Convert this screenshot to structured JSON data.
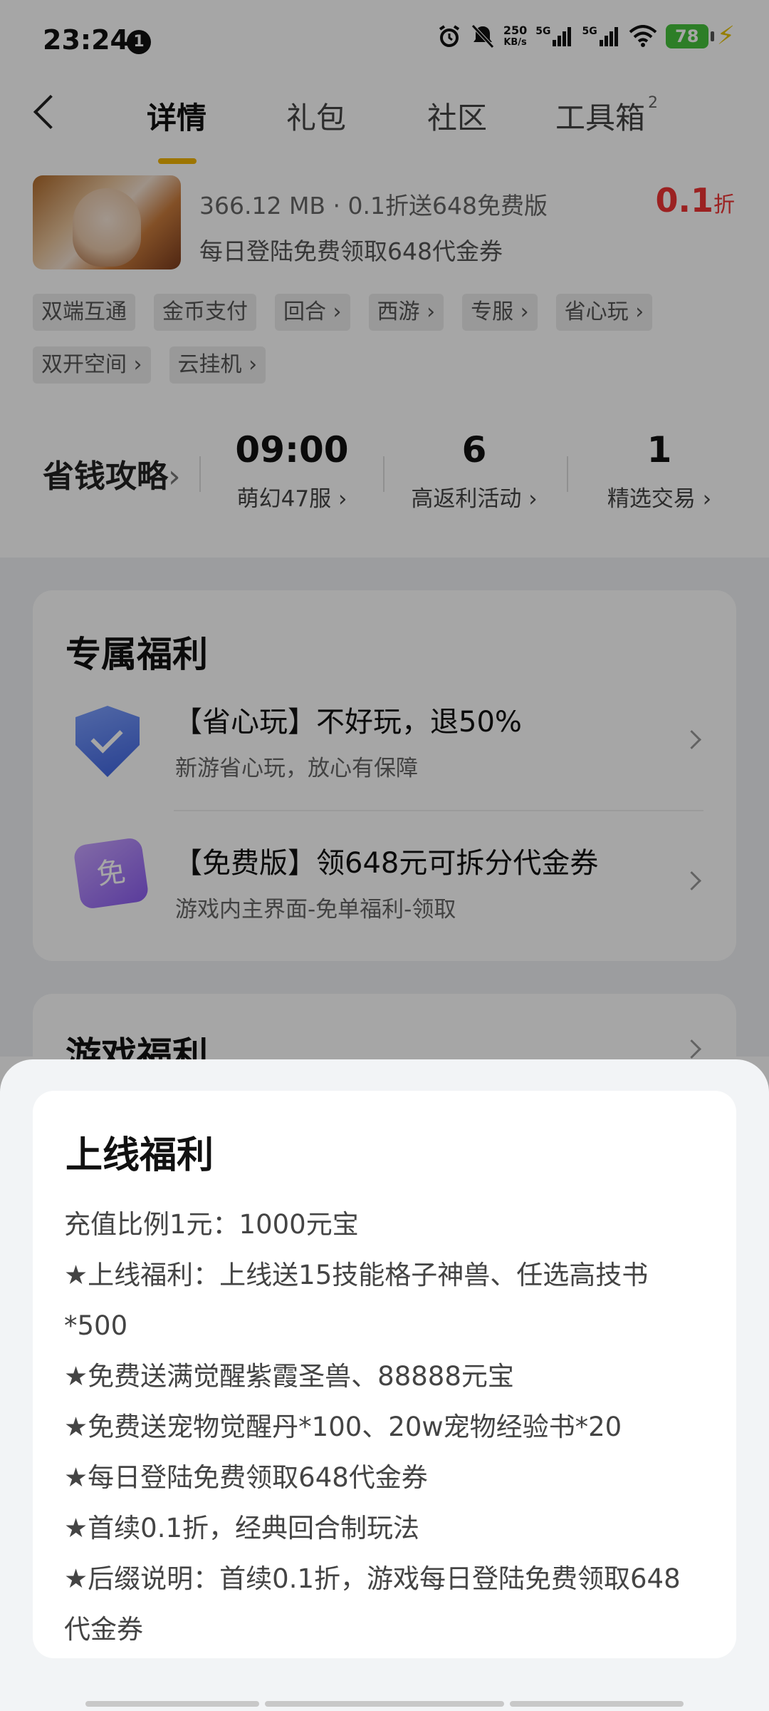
{
  "status_bar": {
    "time": "23:24",
    "notification_count": "1",
    "net_speed_value": "250",
    "net_speed_unit": "KB/s",
    "signal1_label": "5G",
    "signal2_label": "5G",
    "battery": "78",
    "icons": [
      "alarm-icon",
      "mute-icon",
      "signal-icon",
      "signal-icon",
      "wifi-icon",
      "battery-icon",
      "charging-icon"
    ]
  },
  "tabs": [
    {
      "label": "详情"
    },
    {
      "label": "礼包"
    },
    {
      "label": "社区"
    },
    {
      "label": "工具箱",
      "badge": "2"
    }
  ],
  "game": {
    "meta": "366.12 MB · 0.1折送648免费版",
    "desc": "每日登陆免费领取648代金券",
    "discount_value": "0.1",
    "discount_unit": "折"
  },
  "tags": [
    "双端互通",
    "金币支付",
    "回合",
    "西游",
    "专服",
    "省心玩",
    "双开空间",
    "云挂机"
  ],
  "stats": {
    "guide_label": "省钱攻略",
    "items": [
      {
        "value": "09:00",
        "label": "萌幻47服"
      },
      {
        "value": "6",
        "label": "高返利活动"
      },
      {
        "value": "1",
        "label": "精选交易"
      }
    ]
  },
  "exclusive": {
    "title": "专属福利",
    "items": [
      {
        "title": "【省心玩】不好玩，退50%",
        "subtitle": "新游省心玩，放心有保障"
      },
      {
        "title": "【免费版】领648元可拆分代金券",
        "subtitle": "游戏内主界面-免单福利-领取",
        "badge": "免"
      }
    ]
  },
  "game_benefits": {
    "title": "游戏福利"
  },
  "sheet": {
    "title": "上线福利",
    "lines": [
      "充值比例1元：1000元宝",
      "★上线福利：上线送15技能格子神兽、任选高技书",
      "*500",
      "★免费送满觉醒紫霞圣兽、88888元宝",
      "★免费送宠物觉醒丹*100、20w宠物经验书*20",
      "★每日登陆免费领取648代金券",
      "★首续0.1折，经典回合制玩法",
      "★后缀说明：首续0.1折，游戏每日登陆免费领取648",
      "代金券"
    ]
  },
  "colors": {
    "accent": "#f2b400",
    "discount": "#e33333",
    "battery": "#46c23d"
  }
}
